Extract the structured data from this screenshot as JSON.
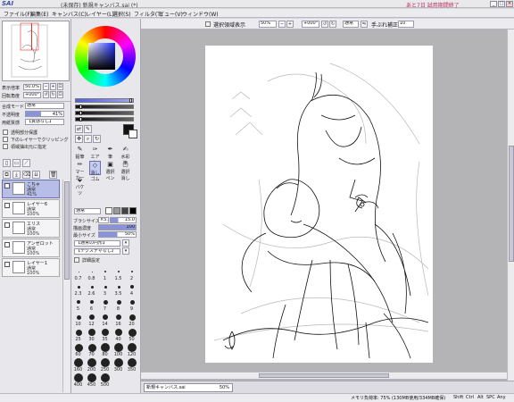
{
  "app": {
    "logo": "SAI",
    "title": "(未保存) 新規キャンバス.sai (*)",
    "trial": "あと7日 試用期間終了"
  },
  "window_controls": [
    "_",
    "□",
    "×"
  ],
  "menu": [
    "ファイル(F)",
    "編集(E)",
    "キャンバス(C)",
    "レイヤー(L)",
    "選択(S)",
    "フィルタ(T)",
    "ビュー(V)",
    "ウィンドウ(W)"
  ],
  "navigator": {
    "zoom_label": "表示倍率",
    "zoom_value": "50.0%",
    "angle_label": "回転角度",
    "angle_value": "+000°"
  },
  "layer_props": {
    "blend_label": "合成モード",
    "blend_value": "通常",
    "opacity_label": "不透明度",
    "opacity_value": "41%",
    "paper_label": "用紙質感",
    "paper_value": "【質感なし】",
    "protect_alpha": "透明部分保護",
    "clip": "下のレイヤーでクリッピング",
    "sel_source": "領域抽出元に指定"
  },
  "layers": [
    {
      "name": "こちゃ",
      "mode": "通常",
      "opacity": "41%",
      "selected": true
    },
    {
      "name": "レイヤー6",
      "mode": "通常",
      "opacity": "100%",
      "selected": false
    },
    {
      "name": "エリス",
      "mode": "通常",
      "opacity": "100%",
      "selected": false
    },
    {
      "name": "アンゼロット",
      "mode": "通常",
      "opacity": "100%",
      "selected": false
    },
    {
      "name": "レイヤー1",
      "mode": "通常",
      "opacity": "100%",
      "selected": false
    }
  ],
  "tools_row1": [
    {
      "label": "鉛筆",
      "glyph": "✎"
    },
    {
      "label": "エアブラシ",
      "glyph": "✑"
    },
    {
      "label": "筆",
      "glyph": "✒"
    },
    {
      "label": "水彩筆",
      "glyph": "✍"
    }
  ],
  "tools_row2": [
    {
      "label": "マーカー",
      "glyph": "✏"
    },
    {
      "label": "消しゴム",
      "glyph": "◇"
    },
    {
      "label": "選択ペン",
      "glyph": "▣"
    },
    {
      "label": "選択消し",
      "glyph": "▢"
    }
  ],
  "tools_row3": [
    {
      "label": "バケツ",
      "glyph": "⬙"
    }
  ],
  "brush": {
    "mode_value": "通常",
    "size_label": "ブラシサイズ",
    "size_mult": "×5.0",
    "size_value": "15.0",
    "density_label": "描画濃度",
    "density_value": "100",
    "min_size_label": "最小サイズ",
    "min_size_value": "50%",
    "shape_value": "【通常の円形】",
    "texture_value": "【テクスチャなし】",
    "detail": "詳細設定"
  },
  "brush_sizes": [
    "0.7",
    "0.8",
    "1",
    "1.5",
    "2",
    "2.3",
    "2.6",
    "3",
    "3.5",
    "4",
    "5",
    "6",
    "7",
    "8",
    "9",
    "10",
    "12",
    "14",
    "16",
    "20",
    "25",
    "30",
    "35",
    "40",
    "50",
    "60",
    "70",
    "80",
    "100",
    "120",
    "160",
    "200",
    "250",
    "300",
    "350",
    "400",
    "450",
    "500"
  ],
  "toolbar": {
    "stabilizer_check": "選択領域表示",
    "zoom_value": "50%",
    "angle_value": "+000°",
    "mode_value": "通常",
    "stab_label": "手ぶれ補正",
    "stab_value": "10"
  },
  "tab": {
    "name": "新規キャンバス.sai",
    "zoom": "50%"
  },
  "status": {
    "memory": "メモリ負荷率: 75% (130MB使用/334MB確保)",
    "keys": [
      "Shift",
      "Ctrl",
      "Alt",
      "SPC",
      "Any"
    ]
  },
  "colors": {
    "accent": "#3a4fa0",
    "selection": "#b6bde6",
    "canvas_bg": "#b4b4b7"
  }
}
